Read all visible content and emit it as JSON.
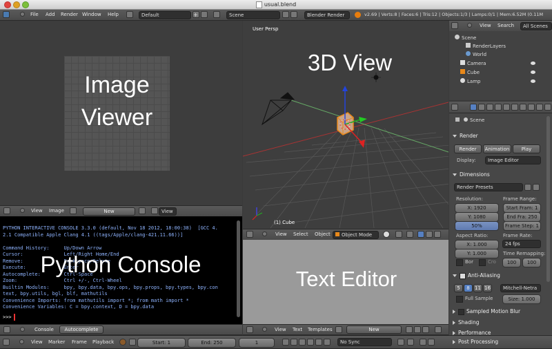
{
  "window": {
    "title": "usual.blend"
  },
  "topbar": {
    "menus": [
      "File",
      "Add",
      "Render",
      "Window",
      "Help"
    ],
    "layout": "Default",
    "scene": "Scene",
    "engine": "Blender Render",
    "stats": "v2.69 | Verts:8 | Faces:6 | Tris:12 | Objects:1/3 | Lamps:0/1 | Mem:6.52M (0.11M"
  },
  "image_viewer": {
    "label_line1": "Image",
    "label_line2": "Viewer",
    "header": {
      "view": "View",
      "image": "Image",
      "new": "New",
      "view2": "View"
    }
  },
  "view3d": {
    "persp_label": "User Persp",
    "big_label": "3D View",
    "object_label": "(1) Cube",
    "header": {
      "view": "View",
      "select": "Select",
      "object": "Object",
      "mode": "Object Mode"
    }
  },
  "console": {
    "big_label": "Python Console",
    "lines": [
      "PYTHON INTERACTIVE CONSOLE 3.3.0 (default, Nov 18 2012, 18:00:38)  [GCC 4.",
      "2.1 Compatible Apple Clang 4.1 ((tags/Apple/clang-421.11.66))]",
      "",
      "Command History:     Up/Down Arrow",
      "Cursor:              Left/Right Home/End",
      "Remove:              Backspace/Delete",
      "Execute:             Enter",
      "Autocomplete:        Ctrl-Space",
      "Zoom:                Ctrl +/-, Ctrl-Wheel",
      "Builtin Modules:     bpy, bpy.data, bpy.ops, bpy.props, bpy.types, bpy.con",
      "text, bpy.utils, bgl, blf, mathutils",
      "Convenience Imports: from mathutils import *; from math import *",
      "Convenience Variables: C = bpy.context, D = bpy.data"
    ],
    "prompt": ">>> ",
    "header": {
      "console": "Console",
      "autocomplete": "Autocomplete"
    }
  },
  "text_editor": {
    "big_label": "Text Editor",
    "header": {
      "view": "View",
      "text": "Text",
      "templates": "Templates",
      "new": "New"
    }
  },
  "timeline": {
    "view": "View",
    "marker": "Marker",
    "frame": "Frame",
    "playback": "Playback",
    "start": "Start: 1",
    "end": "End: 250",
    "current": "1",
    "sync": "No Sync"
  },
  "outliner": {
    "view": "View",
    "search": "Search",
    "all_scenes": "All Scenes",
    "items": [
      "Scene",
      "RenderLayers",
      "World",
      "Camera",
      "Cube",
      "Lamp"
    ]
  },
  "properties": {
    "context": "Scene",
    "render": {
      "title": "Render",
      "render_btn": "Render",
      "animation_btn": "Animation",
      "play_btn": "Play",
      "display_label": "Display:",
      "display_value": "Image Editor"
    },
    "dimensions": {
      "title": "Dimensions",
      "presets": "Render Presets",
      "resolution_label": "Resolution:",
      "res_x": "X: 1920",
      "res_y": "Y: 1080",
      "res_pct": "50%",
      "frame_range_label": "Frame Range:",
      "start_frame": "Start Fram: 1",
      "end_frame": "End Fra: 250",
      "frame_step": "Frame Step: 1",
      "aspect_label": "Aspect Ratio:",
      "aspect_x": "X: 1.000",
      "aspect_y": "Y: 1.000",
      "frame_rate_label": "Frame Rate:",
      "frame_rate": "24 fps",
      "time_remap_label": "Time Remapping:",
      "remap_old": "100",
      "remap_new": "100",
      "border": "Bor",
      "crop": "Cro"
    },
    "anti_aliasing": {
      "title": "Anti-Aliasing",
      "samples": [
        "5",
        "8",
        "11",
        "16"
      ],
      "filter": "Mitchell-Netra",
      "full_sample": "Full Sample",
      "size": "Size: 1.000"
    },
    "collapsed_panels": [
      "Sampled Motion Blur",
      "Shading",
      "Performance",
      "Post Processing"
    ]
  }
}
